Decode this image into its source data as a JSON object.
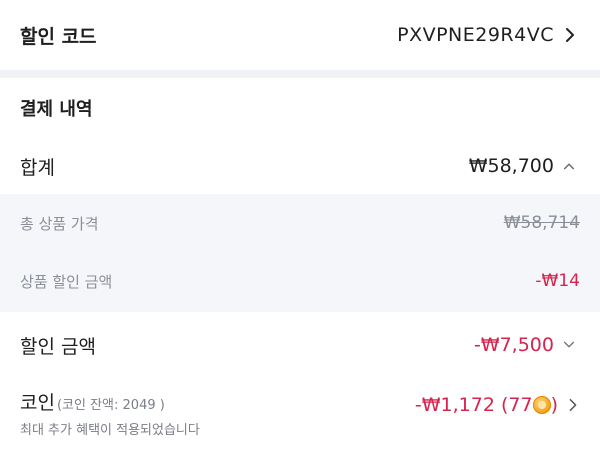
{
  "discount_code": {
    "label": "할인 코드",
    "value": "PXVPNE29R4VC"
  },
  "payment": {
    "section_title": "결제 내역",
    "total": {
      "label": "합계",
      "value": "₩58,700"
    },
    "product_total": {
      "label": "총 상품 가격",
      "value": "₩58,714"
    },
    "product_discount": {
      "label": "상품 할인 금액",
      "value": "-₩14"
    },
    "discount_amount": {
      "label": "할인 금액",
      "value": "-₩7,500"
    },
    "coin": {
      "label": "코인",
      "balance": "(코인 잔액: 2049 )",
      "note": "최대 추가 혜택이 적용되었습니다",
      "value": "-₩1,172 (77",
      "value_suffix": ")"
    }
  },
  "colors": {
    "accent_red": "#d6244e",
    "muted_text": "#8b8f97",
    "background": "#f1f2f5"
  },
  "icons": [
    "chevron-right-icon",
    "chevron-up-icon",
    "chevron-down-icon",
    "coin-icon"
  ]
}
